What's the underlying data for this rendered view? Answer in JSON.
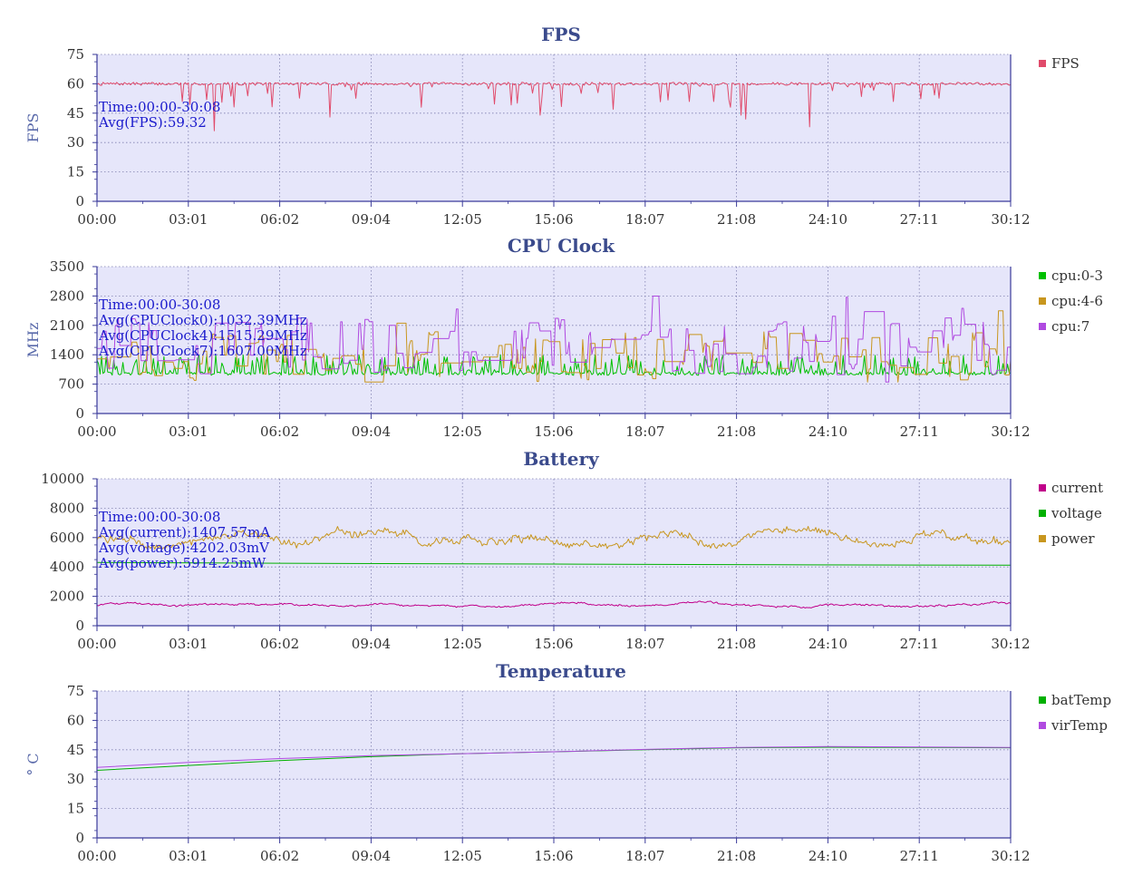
{
  "palette": {
    "plot_bg": "#e6e6fa",
    "axis": "#3a3a9a",
    "title": "#3a4a8c",
    "annot": "#1a1acc"
  },
  "x_ticks": [
    "00:00",
    "03:01",
    "06:02",
    "09:04",
    "12:05",
    "15:06",
    "18:07",
    "21:08",
    "24:10",
    "27:11",
    "30:12"
  ],
  "chart_data": [
    {
      "type": "line",
      "title": "FPS",
      "ylabel": "FPS",
      "xlim": [
        "00:00",
        "30:12"
      ],
      "ylim": [
        0,
        75
      ],
      "yticks": [
        0,
        15,
        30,
        45,
        60,
        75
      ],
      "grid": true,
      "legend": "right",
      "annotations": [
        "Time:00:00-30:08",
        "Avg(FPS):59.32"
      ],
      "series": [
        {
          "name": "FPS",
          "color": "#e04b6b",
          "baseline": 60,
          "noise": 1.5,
          "dip_rate": 0.06,
          "dip_max": 12,
          "dips": [
            [
              0.128,
              36
            ],
            [
              0.255,
              43
            ],
            [
              0.485,
              44
            ],
            [
              0.565,
              47
            ],
            [
              0.705,
              44
            ],
            [
              0.71,
              42
            ],
            [
              0.78,
              38
            ]
          ]
        }
      ]
    },
    {
      "type": "line",
      "title": "CPU Clock",
      "ylabel": "MHz",
      "xlim": [
        "00:00",
        "30:12"
      ],
      "ylim": [
        0,
        3500
      ],
      "yticks": [
        0,
        700,
        1400,
        2100,
        2800,
        3500
      ],
      "grid": true,
      "legend": "right",
      "annotations": [
        "Time:00:00-30:08",
        "Avg(CPUClock0):1032.39MHz",
        "Avg(CPUClock4):1515.29MHz",
        "Avg(CPUClock7):1607.00MHz"
      ],
      "series": [
        {
          "name": "cpu:0-3",
          "color": "#00c000",
          "mode": "spiky",
          "base": 950,
          "amp": 450,
          "p": 0.35
        },
        {
          "name": "cpu:4-6",
          "color": "#c8961e",
          "mode": "steps",
          "base": 1300,
          "amp": 600
        },
        {
          "name": "cpu:7",
          "color": "#b04ae0",
          "mode": "steps",
          "base": 1550,
          "amp": 700
        }
      ]
    },
    {
      "type": "line",
      "title": "Battery",
      "ylabel": "",
      "xlim": [
        "00:00",
        "30:12"
      ],
      "ylim": [
        0,
        10000
      ],
      "yticks": [
        0,
        2000,
        4000,
        6000,
        8000,
        10000
      ],
      "grid": true,
      "legend": "right",
      "annotations": [
        "Time:00:00-30:08",
        "Avg(current):1407.57mA",
        "Avg(voltage):4202.03mV",
        "Avg(power):5914.25mW"
      ],
      "series": [
        {
          "name": "current",
          "color": "#c0008a",
          "mode": "wobble",
          "base": 1400,
          "amp": 180
        },
        {
          "name": "voltage",
          "color": "#00b000",
          "mode": "line",
          "values": [
            [
              0,
              4300
            ],
            [
              0.2,
              4250
            ],
            [
              0.5,
              4200
            ],
            [
              0.75,
              4150
            ],
            [
              1,
              4120
            ]
          ]
        },
        {
          "name": "power",
          "color": "#c8961e",
          "mode": "wobble",
          "base": 5900,
          "amp": 700
        }
      ]
    },
    {
      "type": "line",
      "title": "Temperature",
      "ylabel": "° C",
      "xlim": [
        "00:00",
        "30:12"
      ],
      "ylim": [
        0,
        75
      ],
      "yticks": [
        0,
        15,
        30,
        45,
        60,
        75
      ],
      "grid": true,
      "legend": "right",
      "annotations": [],
      "series": [
        {
          "name": "batTemp",
          "color": "#00b000",
          "mode": "line",
          "values": [
            [
              0,
              34.5
            ],
            [
              0.1,
              37
            ],
            [
              0.2,
              39.5
            ],
            [
              0.3,
              41.5
            ],
            [
              0.4,
              43
            ],
            [
              0.5,
              44
            ],
            [
              0.6,
              45
            ],
            [
              0.7,
              46
            ],
            [
              0.8,
              46.3
            ],
            [
              0.9,
              46.2
            ],
            [
              1,
              46
            ]
          ]
        },
        {
          "name": "virTemp",
          "color": "#b04ae0",
          "mode": "line",
          "values": [
            [
              0,
              36
            ],
            [
              0.1,
              38.5
            ],
            [
              0.2,
              40.5
            ],
            [
              0.3,
              42
            ],
            [
              0.4,
              43
            ],
            [
              0.5,
              44
            ],
            [
              0.6,
              45.2
            ],
            [
              0.7,
              46.2
            ],
            [
              0.8,
              46.6
            ],
            [
              0.9,
              46.4
            ],
            [
              1,
              46.2
            ]
          ]
        }
      ]
    }
  ]
}
